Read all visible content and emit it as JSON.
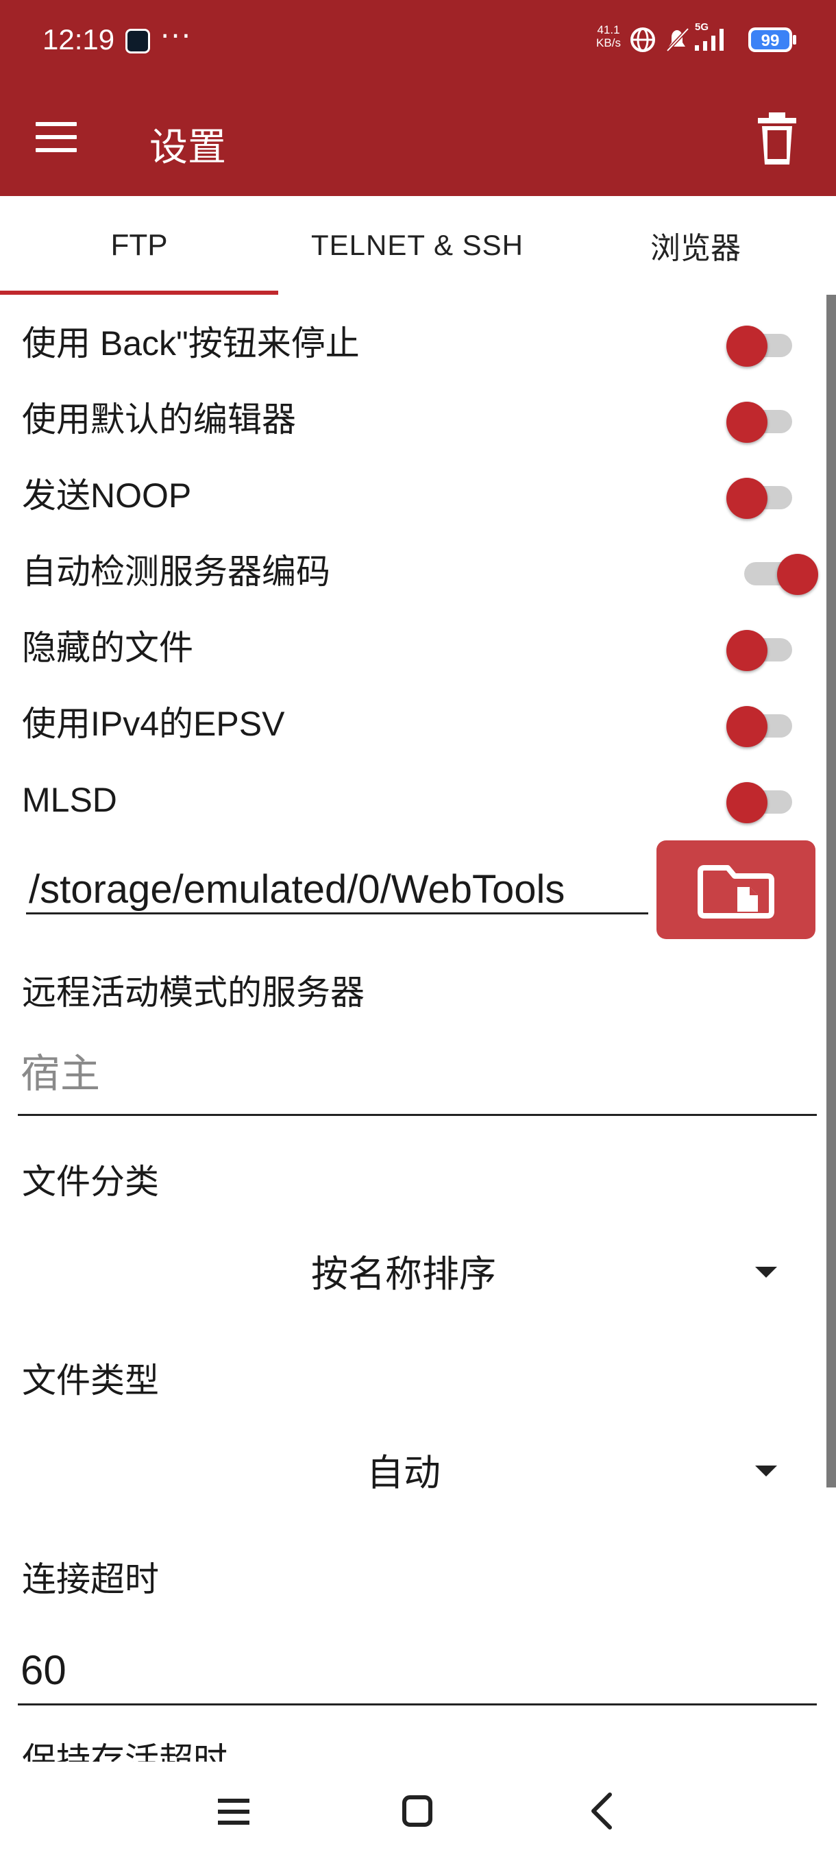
{
  "status_bar": {
    "time": "12:19",
    "more": "···",
    "speed_value": "41.1",
    "speed_unit": "KB/s",
    "network": "5G",
    "battery": "99"
  },
  "toolbar": {
    "title": "设置"
  },
  "tabs": [
    {
      "label": "FTP",
      "active": true
    },
    {
      "label": "TELNET & SSH",
      "active": false
    },
    {
      "label": "浏览器",
      "active": false
    }
  ],
  "toggles": [
    {
      "label": "使用 Back\"按钮来停止",
      "on": false
    },
    {
      "label": "使用默认的编辑器",
      "on": false
    },
    {
      "label": "发送NOOP",
      "on": false
    },
    {
      "label": "自动检测服务器编码",
      "on": true
    },
    {
      "label": "隐藏的文件",
      "on": false
    },
    {
      "label": "使用IPv4的EPSV",
      "on": false
    },
    {
      "label": "MLSD",
      "on": false
    }
  ],
  "path": {
    "value": "/storage/emulated/0/WebTools"
  },
  "remote_server": {
    "label": "远程活动模式的服务器",
    "placeholder": "宿主"
  },
  "file_sort": {
    "label": "文件分类",
    "value": "按名称排序"
  },
  "file_type": {
    "label": "文件类型",
    "value": "自动"
  },
  "connect_timeout": {
    "label": "连接超时",
    "value": "60"
  },
  "keepalive_timeout": {
    "label": "保持存活超时"
  },
  "colors": {
    "primary": "#a02327",
    "accent": "#c0282d",
    "folder_button": "#c84145"
  }
}
